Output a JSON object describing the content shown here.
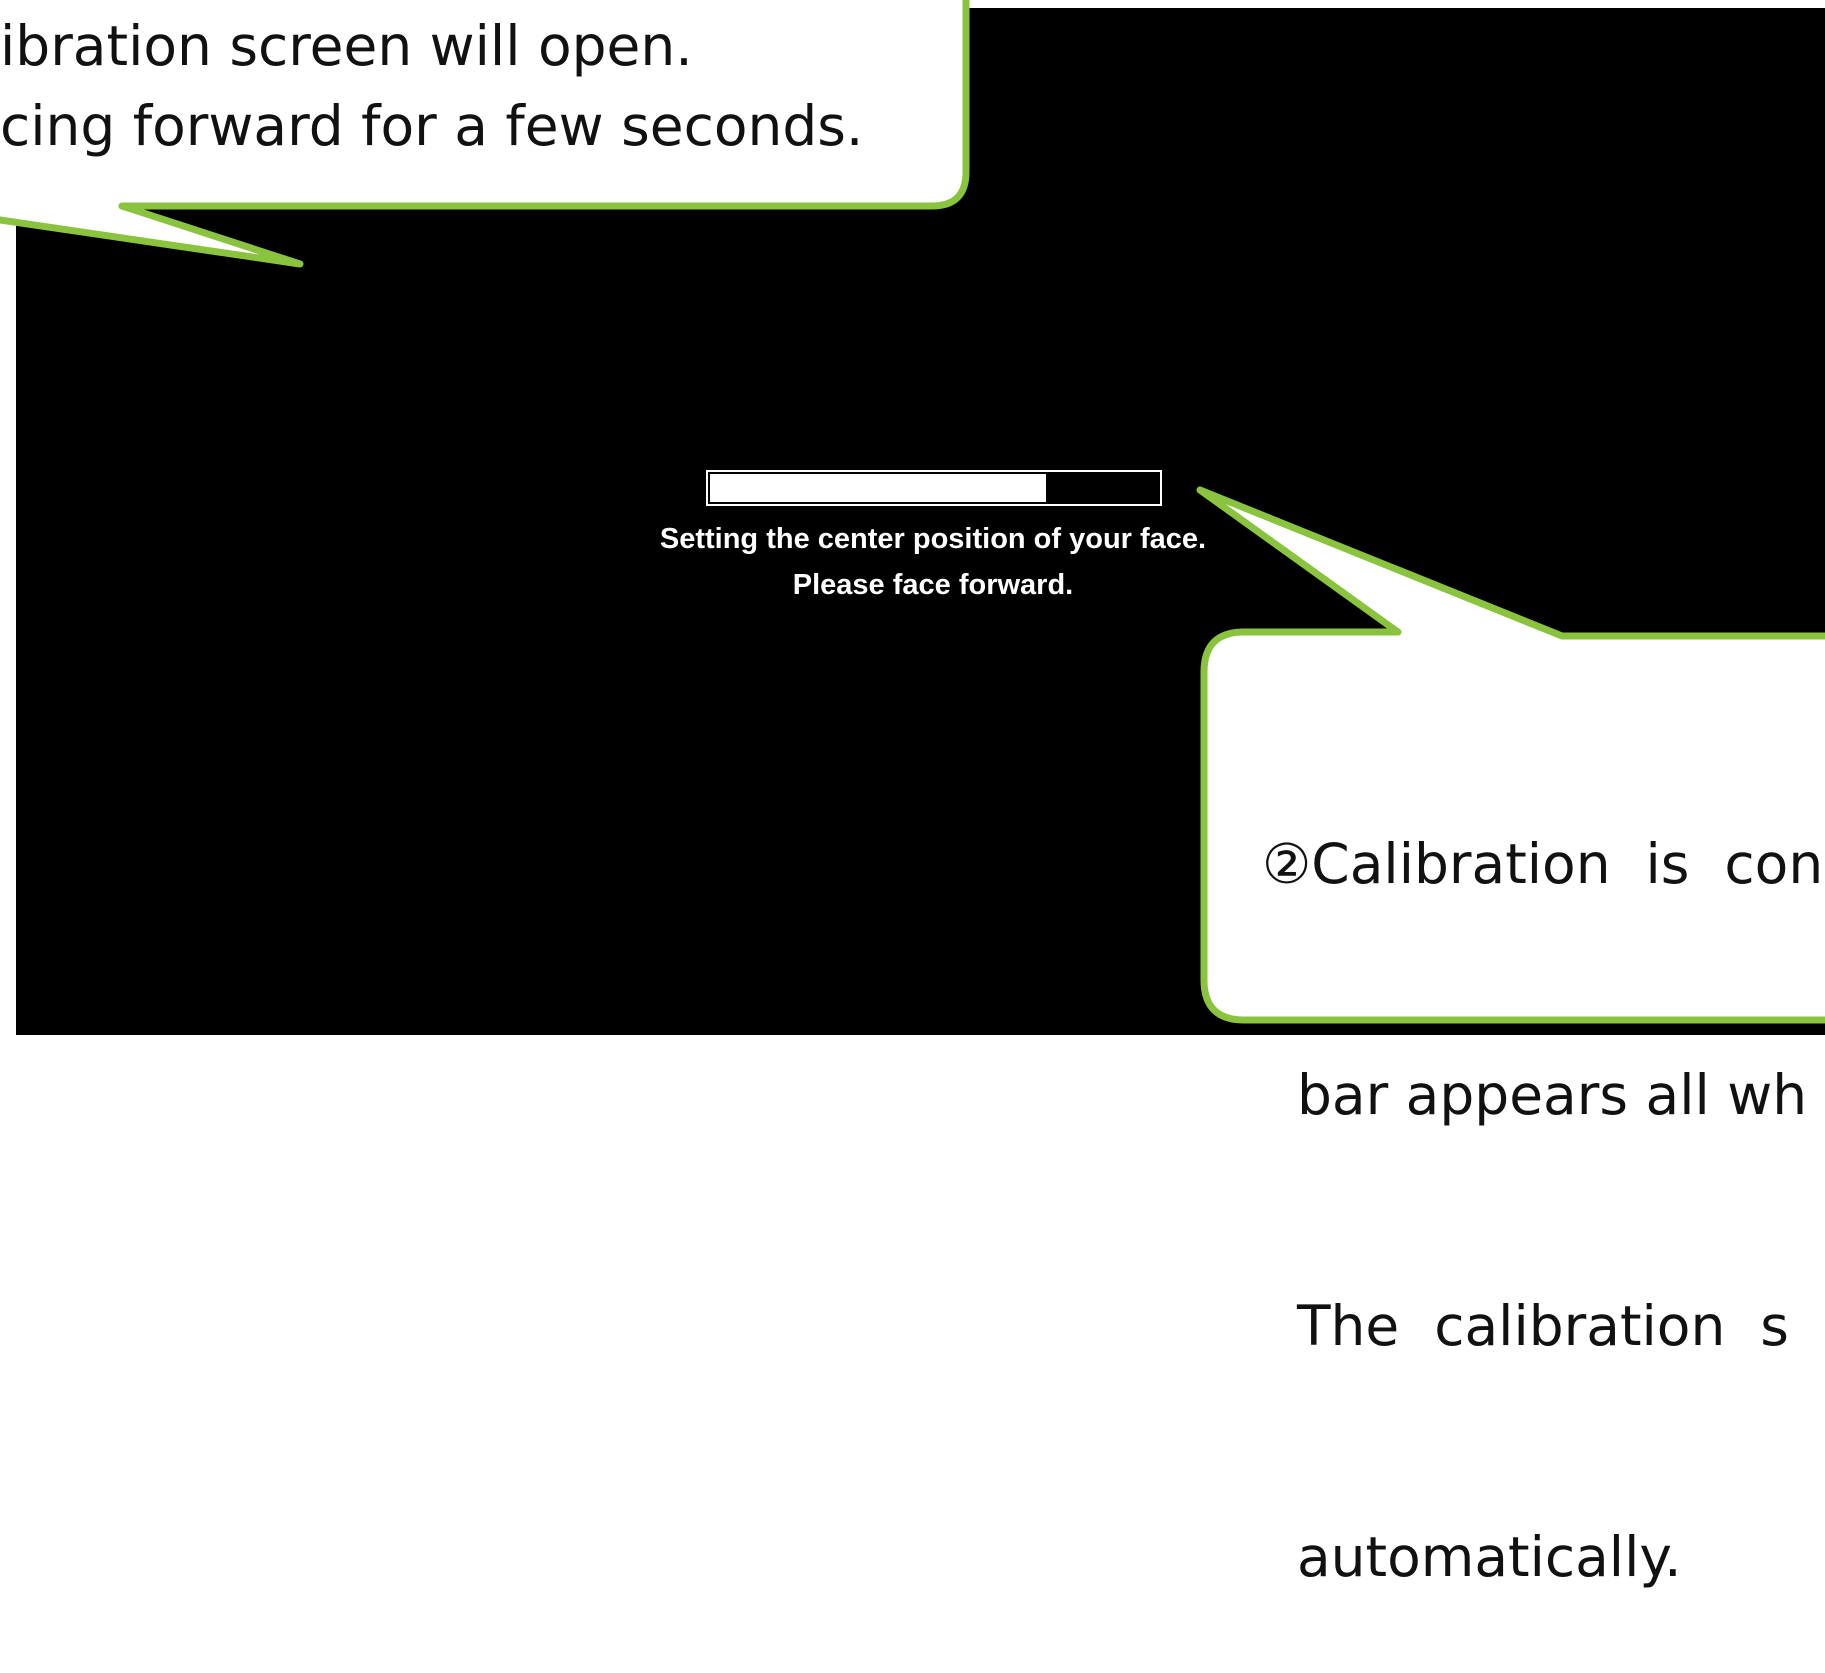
{
  "calibration_screen": {
    "progress_percent": 75,
    "status_line_1": "Setting the center position of your face.",
    "status_line_2": "Please face forward."
  },
  "callout_top": {
    "lines": [
      "ibration screen will open.",
      "cing forward for a few seconds."
    ]
  },
  "callout_bottom": {
    "lines": [
      "②Calibration  is  con",
      "  bar appears all wh",
      "  The  calibration  s",
      "  automatically."
    ]
  },
  "colors": {
    "callout_border": "#8ac43f",
    "callout_fill": "#ffffff",
    "screen_bg": "#000000"
  }
}
